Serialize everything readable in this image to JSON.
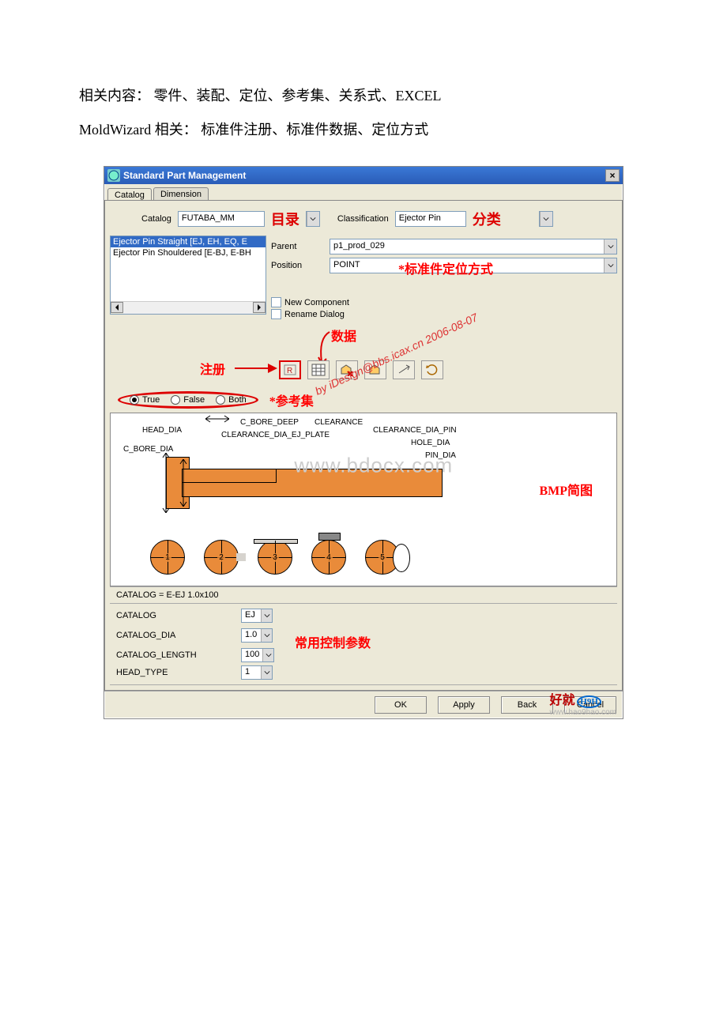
{
  "doc": {
    "line1": "相关内容： 零件、装配、定位、参考集、关系式、EXCEL",
    "line2": "MoldWizard 相关： 标准件注册、标准件数据、定位方式"
  },
  "window": {
    "title": "Standard Part Management",
    "close": "×"
  },
  "tabs": {
    "catalog": "Catalog",
    "dimension": "Dimension"
  },
  "catalog": {
    "catalogLabel": "Catalog",
    "catalogValue": "FUTABA_MM",
    "catalogAnn": "目录",
    "classLabel": "Classification",
    "classValue": "Ejector Pin",
    "classAnn": "分类"
  },
  "list": {
    "item1": "Ejector Pin Straight [EJ, EH, EQ, E",
    "item2": "Ejector Pin Shouldered [E-BJ, E-BH"
  },
  "fields": {
    "parentLabel": "Parent",
    "parentValue": "p1_prod_029",
    "positionLabel": "Position",
    "positionValue": "POINT",
    "positionAnn": "*标准件定位方式"
  },
  "checks": {
    "newComponent": "New Component",
    "renameDialog": "Rename Dialog"
  },
  "ann": {
    "data": "数据",
    "register": "注册",
    "refset": "*参考集",
    "bmp": "BMP简图",
    "params": "常用控制参数"
  },
  "radios": {
    "true": "True",
    "false": "False",
    "both": "Both"
  },
  "bmp": {
    "head_dia": "HEAD_DIA",
    "c_bore_dia": "C_BORE_DIA",
    "c_bore_deep": "C_BORE_DEEP",
    "clearance": "CLEARANCE",
    "clearance_dia_ej": "CLEARANCE_DIA_EJ_PLATE",
    "clearance_dia_pin": "CLEARANCE_DIA_PIN",
    "hole_dia": "HOLE_DIA",
    "pin_dia": "PIN_DIA",
    "c1": "1",
    "c2": "2",
    "c3": "3",
    "c4": "4",
    "c5": "5"
  },
  "catalogLine": "CATALOG = E-EJ 1.0x100",
  "params": {
    "p1": {
      "label": "CATALOG",
      "value": "EJ"
    },
    "p2": {
      "label": "CATALOG_DIA",
      "value": "1.0"
    },
    "p3": {
      "label": "CATALOG_LENGTH",
      "value": "100"
    },
    "p4": {
      "label": "HEAD_TYPE",
      "value": "1"
    }
  },
  "buttons": {
    "ok": "OK",
    "apply": "Apply",
    "back": "Back",
    "cancel": "Cancel"
  },
  "watermark": {
    "center": "www.bdocx.com",
    "diag": "by iDesign@bbs.icax.cn 2006-08-07",
    "corner_cn": "好就",
    "corner_url": "www.hao9hao.com",
    "corner_tag": "H9H"
  }
}
